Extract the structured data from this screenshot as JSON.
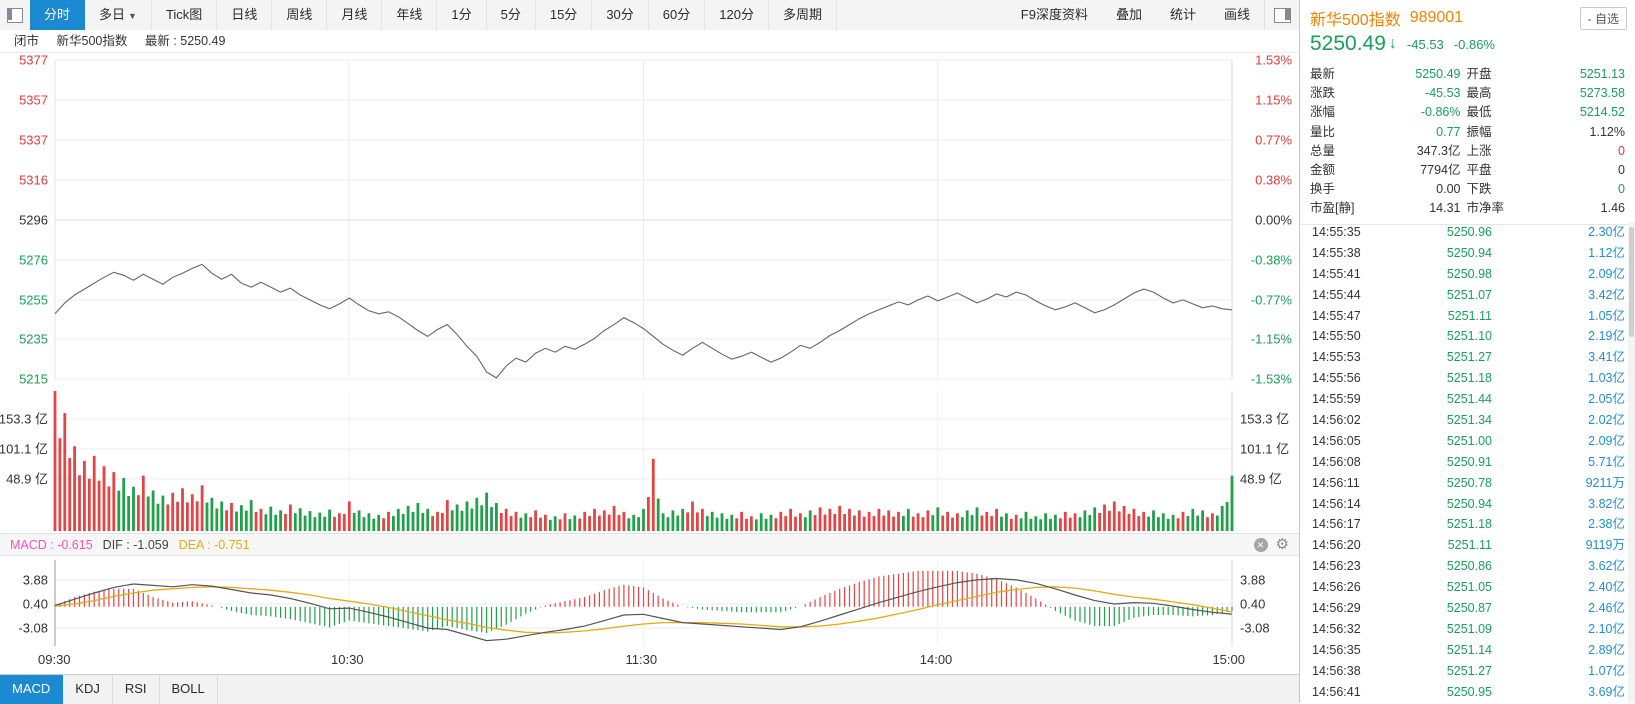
{
  "colors": {
    "up_red": "#e23b3b",
    "down_green": "#18a058",
    "flat": "#333333",
    "vol_blue": "#1e8fd4",
    "orange": "#f28300",
    "macd_pink": "#ff52b3",
    "dea_yellow": "#e3ac12",
    "price_line": "#666666",
    "dif_line": "#555555",
    "bar_red": "#e34444",
    "bar_green": "#21a04a",
    "active_tab": "#1b8ad2"
  },
  "toolbar": {
    "tabs": [
      {
        "label": "分时",
        "active": true
      },
      {
        "label": "多日",
        "caret": true
      },
      {
        "label": "Tick图"
      },
      {
        "label": "日线"
      },
      {
        "label": "周线"
      },
      {
        "label": "月线"
      },
      {
        "label": "年线"
      },
      {
        "label": "1分"
      },
      {
        "label": "5分"
      },
      {
        "label": "15分"
      },
      {
        "label": "30分"
      },
      {
        "label": "60分"
      },
      {
        "label": "120分"
      },
      {
        "label": "多周期"
      }
    ],
    "right_items": [
      "F9深度资料",
      "叠加",
      "统计",
      "画线"
    ]
  },
  "statusbar": {
    "market_status": "闭市",
    "index_name": "新华500指数",
    "latest_text": "最新 : 5250.49"
  },
  "macd_header": {
    "macd_text": "MACD : -0.615",
    "dif_text": "DIF : -1.059",
    "dea_text": "DEA : -0.751"
  },
  "bottom_tabs": [
    {
      "label": "MACD",
      "active": true
    },
    {
      "label": "KDJ"
    },
    {
      "label": "RSI"
    },
    {
      "label": "BOLL"
    }
  ],
  "quote": {
    "name": "新华500指数",
    "code": "989001",
    "watch_button": "- 自选",
    "price": "5250.49",
    "arrow": "↓",
    "change": "-45.53",
    "change_pct": "-0.86%",
    "stats": [
      {
        "label": "最新",
        "value": "5250.49",
        "color": "green"
      },
      {
        "label": "开盘",
        "value": "5251.13",
        "color": "green"
      },
      {
        "label": "涨跌",
        "value": "-45.53",
        "color": "green"
      },
      {
        "label": "最高",
        "value": "5273.58",
        "color": "green"
      },
      {
        "label": "涨幅",
        "value": "-0.86%",
        "color": "green"
      },
      {
        "label": "最低",
        "value": "5214.52",
        "color": "green"
      },
      {
        "label": "量比",
        "value": "0.77",
        "color": "green"
      },
      {
        "label": "振幅",
        "value": "1.12%",
        "color": "flat"
      },
      {
        "label": "总量",
        "value": "347.3亿",
        "color": "flat"
      },
      {
        "label": "上涨",
        "value": "0",
        "color": "red"
      },
      {
        "label": "金额",
        "value": "7794亿",
        "color": "flat"
      },
      {
        "label": "平盘",
        "value": "0",
        "color": "flat"
      },
      {
        "label": "换手",
        "value": "0.00",
        "color": "flat"
      },
      {
        "label": "下跌",
        "value": "0",
        "color": "green"
      },
      {
        "label": "市盈[静]",
        "value": "14.31",
        "color": "flat"
      },
      {
        "label": "市净率",
        "value": "1.46",
        "color": "flat"
      }
    ],
    "ticks": [
      {
        "time": "14:55:35",
        "price": "5250.96",
        "vol": "2.30亿"
      },
      {
        "time": "14:55:38",
        "price": "5250.94",
        "vol": "1.12亿"
      },
      {
        "time": "14:55:41",
        "price": "5250.98",
        "vol": "2.09亿"
      },
      {
        "time": "14:55:44",
        "price": "5251.07",
        "vol": "3.42亿"
      },
      {
        "time": "14:55:47",
        "price": "5251.11",
        "vol": "1.05亿"
      },
      {
        "time": "14:55:50",
        "price": "5251.10",
        "vol": "2.19亿"
      },
      {
        "time": "14:55:53",
        "price": "5251.27",
        "vol": "3.41亿"
      },
      {
        "time": "14:55:56",
        "price": "5251.18",
        "vol": "1.03亿"
      },
      {
        "time": "14:55:59",
        "price": "5251.44",
        "vol": "2.05亿"
      },
      {
        "time": "14:56:02",
        "price": "5251.34",
        "vol": "2.02亿"
      },
      {
        "time": "14:56:05",
        "price": "5251.00",
        "vol": "2.09亿"
      },
      {
        "time": "14:56:08",
        "price": "5250.91",
        "vol": "5.71亿"
      },
      {
        "time": "14:56:11",
        "price": "5250.78",
        "vol": "9211万"
      },
      {
        "time": "14:56:14",
        "price": "5250.94",
        "vol": "3.82亿"
      },
      {
        "time": "14:56:17",
        "price": "5251.18",
        "vol": "2.38亿"
      },
      {
        "time": "14:56:20",
        "price": "5251.11",
        "vol": "9119万"
      },
      {
        "time": "14:56:23",
        "price": "5250.86",
        "vol": "3.62亿"
      },
      {
        "time": "14:56:26",
        "price": "5251.05",
        "vol": "2.40亿"
      },
      {
        "time": "14:56:29",
        "price": "5250.87",
        "vol": "2.46亿"
      },
      {
        "time": "14:56:32",
        "price": "5251.09",
        "vol": "2.10亿"
      },
      {
        "time": "14:56:35",
        "price": "5251.14",
        "vol": "2.89亿"
      },
      {
        "time": "14:56:38",
        "price": "5251.27",
        "vol": "1.07亿"
      },
      {
        "time": "14:56:41",
        "price": "5250.95",
        "vol": "3.69亿"
      }
    ]
  },
  "chart_data": {
    "type": "line",
    "title": "新华500指数 分时走势",
    "x_axis": {
      "labels": [
        "09:30",
        "10:30",
        "11:30",
        "14:00",
        "15:00"
      ],
      "minutes_total": 240
    },
    "price_axis": {
      "prev_close": 5296.02,
      "left_ticks": [
        "5377",
        "5357",
        "5337",
        "5316",
        "5296",
        "5276",
        "5255",
        "5235",
        "5215"
      ],
      "right_ticks": [
        "1.53%",
        "1.15%",
        "0.77%",
        "0.38%",
        "0.00%",
        "-0.38%",
        "-0.77%",
        "-1.15%",
        "-1.53%"
      ],
      "tick_colors": [
        "red",
        "red",
        "red",
        "red",
        "flat",
        "green",
        "green",
        "green",
        "green"
      ]
    },
    "price_series": {
      "interval_min": 2,
      "values": [
        5248.5,
        5254,
        5258,
        5261,
        5264,
        5267,
        5269.5,
        5268,
        5265.5,
        5268.5,
        5266,
        5263.5,
        5267,
        5269,
        5271.5,
        5273.5,
        5269,
        5266,
        5268.5,
        5264,
        5262,
        5264.5,
        5262,
        5259.5,
        5261.5,
        5258,
        5255.5,
        5253,
        5251,
        5253.5,
        5256.5,
        5253,
        5250,
        5248.5,
        5249.5,
        5247,
        5243.5,
        5240,
        5237,
        5240.5,
        5243,
        5238,
        5232,
        5227,
        5219,
        5216,
        5222,
        5226,
        5224,
        5228.5,
        5231,
        5229,
        5232,
        5230.5,
        5233,
        5236,
        5240,
        5243,
        5246.5,
        5244,
        5241,
        5237,
        5233,
        5230,
        5227.5,
        5231,
        5234,
        5231,
        5228,
        5225.5,
        5227,
        5229,
        5226.5,
        5224,
        5226,
        5229,
        5232.5,
        5231,
        5234,
        5237.5,
        5240,
        5243,
        5246,
        5248.5,
        5250.5,
        5252.5,
        5254.5,
        5253,
        5255.5,
        5257.5,
        5255,
        5257,
        5259,
        5256.5,
        5254,
        5256,
        5258.5,
        5257,
        5259.5,
        5258,
        5255,
        5252.5,
        5250.5,
        5252,
        5254,
        5251.5,
        5249,
        5250.5,
        5253,
        5256,
        5259,
        5261,
        5259.5,
        5256.5,
        5254,
        5255.5,
        5253.5,
        5251.5,
        5252.5,
        5251,
        5250.49
      ]
    },
    "volume_axis_ticks": [
      "153.3 亿",
      "101.1 亿",
      "48.9 亿"
    ],
    "volume_series": {
      "interval_min": 2,
      "unit": "亿",
      "signed_values": [
        190,
        160,
        115,
        95,
        102,
        88,
        80,
        -72,
        -60,
        75,
        -55,
        -48,
        52,
        58,
        50,
        62,
        -45,
        -40,
        38,
        -35,
        -42,
        30,
        -33,
        -28,
        36,
        -31,
        -27,
        -25,
        -29,
        24,
        40,
        -28,
        -24,
        -22,
        26,
        -30,
        -34,
        -38,
        -30,
        26,
        42,
        -36,
        -40,
        -45,
        -52,
        -38,
        30,
        26,
        -24,
        28,
        22,
        -20,
        24,
        -21,
        26,
        30,
        28,
        34,
        26,
        -22,
        -30,
        98,
        -24,
        -28,
        -30,
        40,
        30,
        -26,
        -24,
        -22,
        26,
        20,
        -24,
        -22,
        26,
        30,
        24,
        -28,
        32,
        30,
        34,
        30,
        28,
        26,
        30,
        28,
        26,
        -30,
        24,
        28,
        -32,
        26,
        24,
        -28,
        -32,
        26,
        30,
        -24,
        22,
        -26,
        -20,
        -24,
        -22,
        26,
        24,
        -28,
        -32,
        36,
        40,
        34,
        30,
        26,
        -28,
        -24,
        -22,
        26,
        -30,
        -28,
        24,
        -34,
        -75
      ]
    },
    "macd": {
      "ticks": [
        "3.88",
        "0.40",
        "-3.08"
      ],
      "interval_min": 4,
      "dif": [
        0.2,
        1.1,
        2.0,
        2.8,
        3.3,
        3.1,
        2.9,
        3.2,
        3.0,
        2.5,
        2.0,
        1.7,
        1.2,
        0.5,
        -0.3,
        -0.2,
        -0.8,
        -1.5,
        -2.3,
        -3.1,
        -3.3,
        -4.1,
        -4.9,
        -4.7,
        -4.2,
        -3.7,
        -3.3,
        -2.8,
        -2.0,
        -1.2,
        -1.1,
        -1.7,
        -2.3,
        -2.5,
        -2.7,
        -2.9,
        -3.1,
        -3.3,
        -2.9,
        -2.1,
        -1.2,
        -0.3,
        0.6,
        1.4,
        2.2,
        2.9,
        3.5,
        3.9,
        4.1,
        3.9,
        3.4,
        2.6,
        1.7,
        0.9,
        0.4,
        0.6,
        0.5,
        0.1,
        -0.4,
        -0.8,
        -1.059
      ],
      "dea": [
        0.1,
        0.4,
        0.9,
        1.5,
        2.0,
        2.4,
        2.6,
        2.8,
        2.9,
        2.8,
        2.6,
        2.4,
        2.1,
        1.7,
        1.2,
        0.8,
        0.4,
        -0.1,
        -0.7,
        -1.3,
        -1.9,
        -2.4,
        -3.0,
        -3.4,
        -3.7,
        -3.8,
        -3.7,
        -3.5,
        -3.2,
        -2.8,
        -2.5,
        -2.3,
        -2.3,
        -2.3,
        -2.4,
        -2.5,
        -2.7,
        -2.9,
        -2.9,
        -2.8,
        -2.5,
        -2.1,
        -1.6,
        -1.0,
        -0.4,
        0.3,
        0.9,
        1.5,
        2.1,
        2.5,
        2.8,
        2.9,
        2.7,
        2.3,
        1.8,
        1.4,
        1.1,
        0.7,
        0.3,
        -0.2,
        -0.751
      ],
      "histogram_rule": "2*(DIF-DEA)"
    }
  }
}
